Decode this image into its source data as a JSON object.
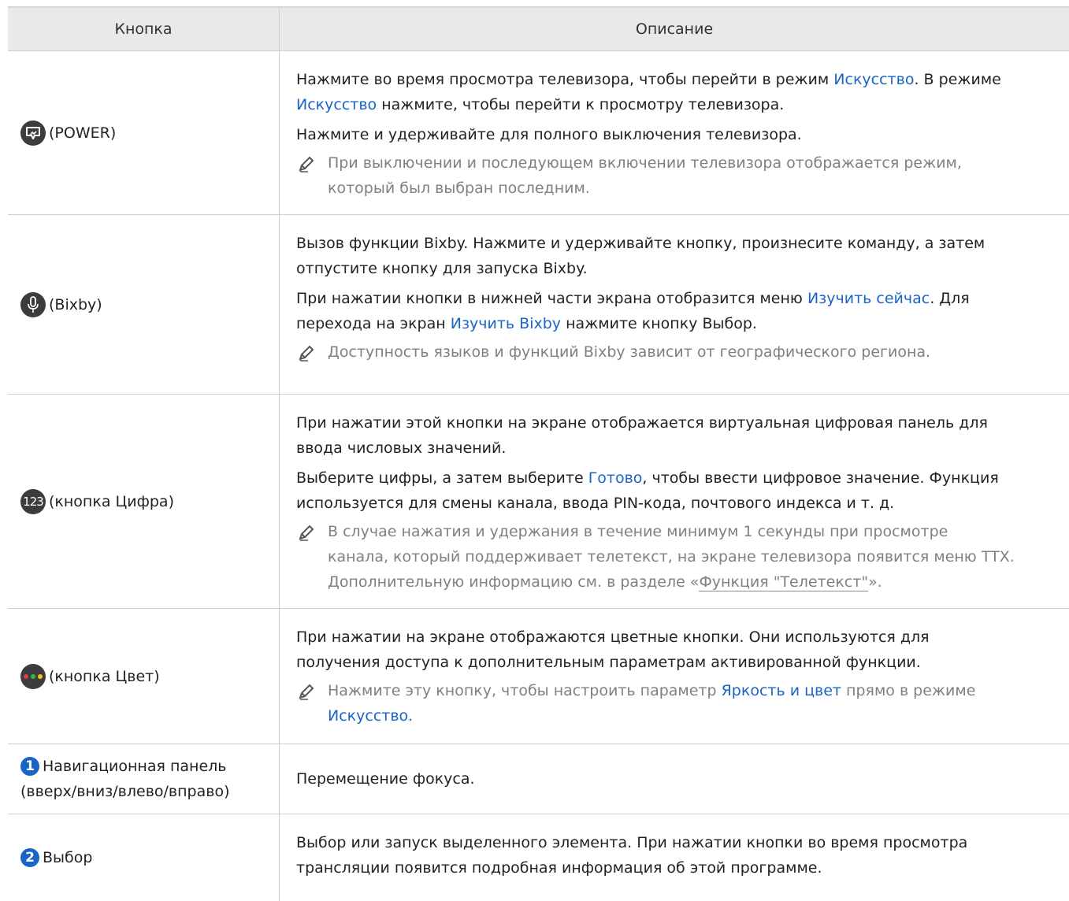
{
  "headers": {
    "button": "Кнопка",
    "description": "Описание"
  },
  "rows": [
    {
      "label": "(POWER)",
      "p1_a": "Нажмите во время просмотра телевизора, чтобы перейти в режим ",
      "p1_link": "Искусство",
      "p1_b": ". В режиме",
      "p2_link": "Искусство",
      "p2_b": " нажмите, чтобы перейти к просмотру телевизора.",
      "p3": "Нажмите и удерживайте для полного выключения телевизора.",
      "note1": "При выключении и последующем включении телевизора отображается режим,",
      "note2": "который был выбран последним."
    },
    {
      "label": "(Bixby)",
      "p1": "Вызов функции Bixby. Нажмите и удерживайте кнопку, произнесите команду, а затем",
      "p2": "отпустите кнопку для запуска Bixby.",
      "p3_a": "При нажатии кнопки в нижней части экрана отобразится меню ",
      "p3_link": "Изучить сейчас",
      "p3_b": ". Для",
      "p4_a": "перехода на экран ",
      "p4_link": "Изучить Bixby",
      "p4_b": " нажмите кнопку Выбор.",
      "note": "Доступность языков и функций Bixby зависит от географического региона."
    },
    {
      "icon_text": "123",
      "label": "(кнопка Цифра)",
      "p1": "При нажатии этой кнопки на экране отображается виртуальная цифровая панель для",
      "p2": "ввода числовых значений.",
      "p3_a": "Выберите цифры, а затем выберите ",
      "p3_link": "Готово",
      "p3_b": ", чтобы ввести цифровое значение. Функция",
      "p4": "используется для смены канала, ввода PIN-кода, почтового индекса и т. д.",
      "note1": "В случае нажатия и удержания в течение минимум 1 секунды при просмотре",
      "note2": "канала, который поддерживает телетекст, на экране телевизора появится меню TTX.",
      "note3_a": "Дополнительную информацию см. в разделе «",
      "note3_link": "Функция \"Телетекст\"",
      "note3_b": "»."
    },
    {
      "label": "(кнопка Цвет)",
      "p1": "При нажатии на экране отображаются цветные кнопки. Они используются для",
      "p2": "получения доступа к дополнительным параметрам активированной функции.",
      "note1_a": "Нажмите эту кнопку, чтобы настроить параметр ",
      "note1_link": "Яркость и цвет",
      "note1_b": " прямо в режиме",
      "note2_link": "Искусство",
      "note2_b": "."
    },
    {
      "num": "1",
      "label1": "Навигационная панель",
      "label2": "(вверх/вниз/влево/вправо)",
      "p1": "Перемещение фокуса."
    },
    {
      "num": "2",
      "label": "Выбор",
      "p1": "Выбор или запуск выделенного элемента. При нажатии кнопки во время просмотра",
      "p2": "трансляции появится подробная информация об этой программе."
    }
  ],
  "colors": {
    "link": "#1a64c8",
    "icon_bg": "#3c3c3c",
    "note": "#808080",
    "header_bg": "#e9e9e9"
  },
  "icons": [
    "power-art-icon",
    "microphone-icon",
    "number-123-icon",
    "color-dots-icon",
    "pencil-note-icon"
  ]
}
